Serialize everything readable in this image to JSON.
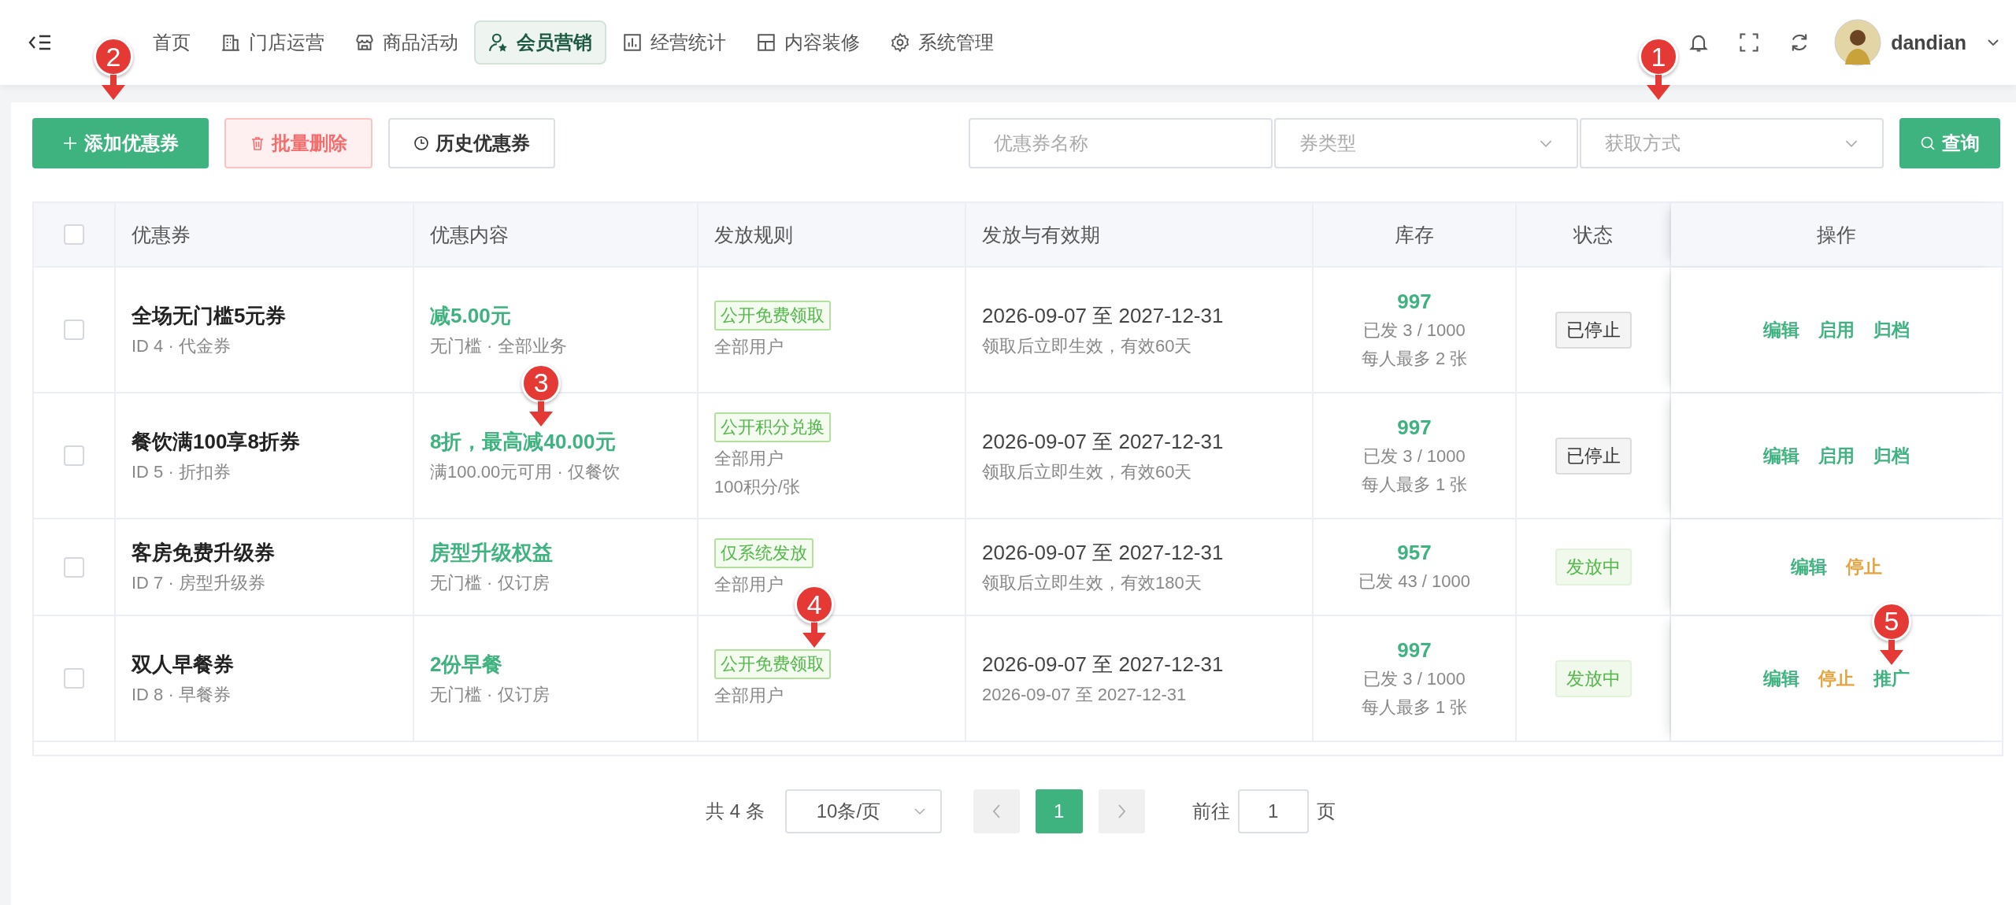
{
  "nav": [
    {
      "label": "首页",
      "selected": false
    },
    {
      "label": "门店运营",
      "selected": false
    },
    {
      "label": "商品活动",
      "selected": false
    },
    {
      "label": "会员营销",
      "selected": true
    },
    {
      "label": "经营统计",
      "selected": false
    },
    {
      "label": "内容装修",
      "selected": false
    },
    {
      "label": "系统管理",
      "selected": false
    }
  ],
  "user": {
    "name": "dandian"
  },
  "toolbar": {
    "buttons": [
      {
        "label": "添加优惠券",
        "kind": "primary",
        "annotation": "2"
      },
      {
        "label": "批量删除",
        "kind": "danger"
      },
      {
        "label": "历史优惠券",
        "kind": "history"
      }
    ],
    "filters": [
      {
        "placeholder": "优惠券名称",
        "kind": "input"
      },
      {
        "placeholder": "券类型",
        "kind": "select"
      },
      {
        "placeholder": "获取方式",
        "kind": "select",
        "annotation": "1"
      }
    ],
    "search": "查询"
  },
  "table": {
    "select_all": {
      "checked": false
    },
    "columns": [
      "优惠券",
      "优惠内容",
      "发放规则",
      "发放与有效期",
      "库存",
      "状态",
      "操作"
    ],
    "rows": [
      {
        "checked": false,
        "name": "全场无门槛5元券",
        "meta": "ID 4 · 代金券",
        "benefit": "减5.00元",
        "benefit_note": "无门槛 · 全部业务",
        "rule_tag": "公开免费领取",
        "rule_lines": [
          "全部用户"
        ],
        "period": "2026-09-07 至 2027-12-31",
        "period_note": "领取后立即生效，有效60天",
        "stock": "997",
        "stock_lines": [
          "已发 3 / 1000",
          "每人最多 2 张"
        ],
        "status": {
          "label": "已停止",
          "kind": "stopped"
        },
        "actions": [
          {
            "label": "编辑",
            "kind": "primary"
          },
          {
            "label": "启用",
            "kind": "primary"
          },
          {
            "label": "归档",
            "kind": "primary"
          }
        ]
      },
      {
        "checked": false,
        "name": "餐饮满100享8折券",
        "meta": "ID 5 · 折扣券",
        "benefit": "8折，最高减40.00元",
        "benefit_annotation": "3",
        "benefit_note": "满100.00元可用 · 仅餐饮",
        "rule_tag": "公开积分兑换",
        "rule_lines": [
          "全部用户",
          "100积分/张"
        ],
        "period": "2026-09-07 至 2027-12-31",
        "period_note": "领取后立即生效，有效60天",
        "stock": "997",
        "stock_lines": [
          "已发 3 / 1000",
          "每人最多 1 张"
        ],
        "status": {
          "label": "已停止",
          "kind": "stopped"
        },
        "actions": [
          {
            "label": "编辑",
            "kind": "primary"
          },
          {
            "label": "启用",
            "kind": "primary"
          },
          {
            "label": "归档",
            "kind": "primary"
          }
        ]
      },
      {
        "checked": false,
        "name": "客房免费升级券",
        "meta": "ID 7 · 房型升级券",
        "benefit": "房型升级权益",
        "benefit_note": "无门槛 · 仅订房",
        "rule_tag": "仅系统发放",
        "rule_lines": [
          "全部用户"
        ],
        "period": "2026-09-07 至 2027-12-31",
        "period_note": "领取后立即生效，有效180天",
        "stock": "957",
        "stock_lines": [
          "已发 43 / 1000"
        ],
        "status": {
          "label": "发放中",
          "kind": "active"
        },
        "actions": [
          {
            "label": "编辑",
            "kind": "primary"
          },
          {
            "label": "停止",
            "kind": "warning"
          }
        ]
      },
      {
        "checked": false,
        "name": "双人早餐券",
        "meta": "ID 8 · 早餐券",
        "benefit": "2份早餐",
        "benefit_note": "无门槛 · 仅订房",
        "rule_tag": "公开免费领取",
        "rule_annotation": "4",
        "rule_lines": [
          "全部用户"
        ],
        "period": "2026-09-07 至 2027-12-31",
        "period_note": "2026-09-07 至 2027-12-31",
        "stock": "997",
        "stock_lines": [
          "已发 3 / 1000",
          "每人最多 1 张"
        ],
        "status": {
          "label": "发放中",
          "kind": "active"
        },
        "actions": [
          {
            "label": "编辑",
            "kind": "primary"
          },
          {
            "label": "停止",
            "kind": "warning"
          },
          {
            "label": "推广",
            "kind": "primary",
            "annotation": "5"
          }
        ]
      }
    ]
  },
  "pagination": {
    "total": "共 4 条",
    "page_size": "10条/页",
    "pages": [
      {
        "label": "1",
        "selected": true
      }
    ],
    "goto": "前往",
    "goto_value": "1",
    "goto_suffix": "页"
  }
}
